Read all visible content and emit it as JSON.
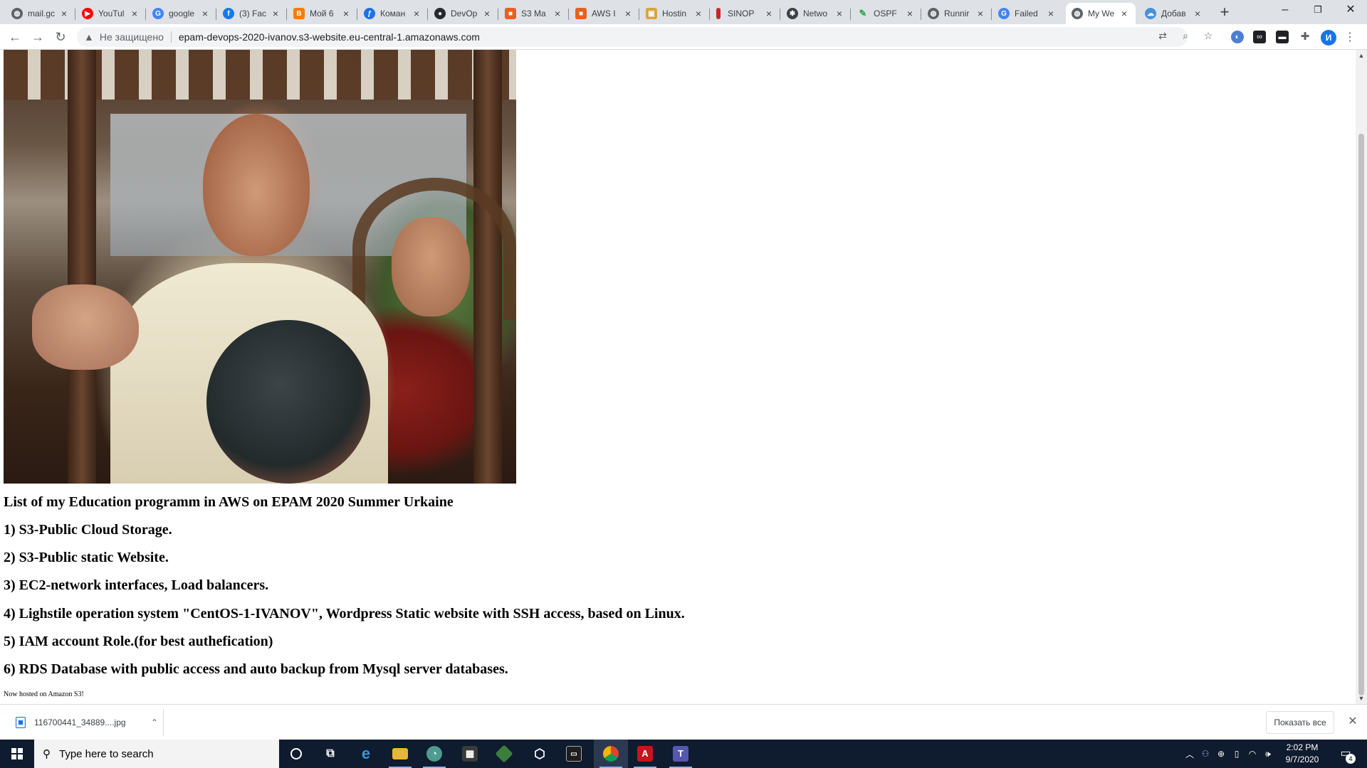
{
  "tabs": [
    {
      "label": "mail.gc",
      "icon": "globe-icon",
      "color": "#5f6368"
    },
    {
      "label": "YouTul",
      "icon": "youtube-icon",
      "color": "#ff0000"
    },
    {
      "label": "google",
      "icon": "google-icon",
      "color": "#4285f4"
    },
    {
      "label": "(3) Fac",
      "icon": "facebook-icon",
      "color": "#1877f2"
    },
    {
      "label": "Мой 6",
      "icon": "blogger-icon",
      "color": "#f57d00"
    },
    {
      "label": "Коман",
      "icon": "translate-icon",
      "color": "#1a73e8"
    },
    {
      "label": "DevOp",
      "icon": "github-icon",
      "color": "#24292e"
    },
    {
      "label": "S3 Ma",
      "icon": "aws-s3-icon",
      "color": "#e7601e"
    },
    {
      "label": "AWS I",
      "icon": "aws-icon",
      "color": "#e7601e"
    },
    {
      "label": "Hostin",
      "icon": "package-icon",
      "color": "#d9a441"
    },
    {
      "label": "SINOP",
      "icon": "thermometer-icon",
      "color": "#c62828"
    },
    {
      "label": "Netwo",
      "icon": "gear-icon",
      "color": "#3c4043"
    },
    {
      "label": "OSPF",
      "icon": "pen-icon",
      "color": "#34a853"
    },
    {
      "label": "Runnir",
      "icon": "globe-icon",
      "color": "#5f6368"
    },
    {
      "label": "Failed",
      "icon": "google-icon",
      "color": "#4285f4"
    },
    {
      "label": "My We",
      "icon": "globe-icon",
      "color": "#5f6368",
      "active": true
    },
    {
      "label": "Добав",
      "icon": "cloud-icon",
      "color": "#4a90d9"
    }
  ],
  "toolbar": {
    "security_label": "Не защищено",
    "url": "epam-devops-2020-ivanov.s3-website.eu-central-1.amazonaws.com",
    "profile_initial": "И"
  },
  "page": {
    "title": "List of my Education programm in AWS on EPAM 2020 Summer Urkaine",
    "items": [
      "1) S3-Public Cloud Storage.",
      "2) S3-Public static Website.",
      "3) EC2-network interfaces, Load balancers.",
      "4) Lighstile operation system \"CentOS-1-IVANOV\", Wordpress Static website with SSH access, based on Linux.",
      "5) IAM account Role.(for best authefication)",
      "6) RDS Database with public access and auto backup from Mysql server databases."
    ],
    "footnote": "Now hosted on Amazon S3!"
  },
  "downloads": {
    "file_name": "116700441_34889....jpg",
    "show_all_label": "Показать все"
  },
  "taskbar": {
    "search_placeholder": "Type here to search",
    "time": "2:02 PM",
    "date": "9/7/2020",
    "notification_count": "4"
  }
}
